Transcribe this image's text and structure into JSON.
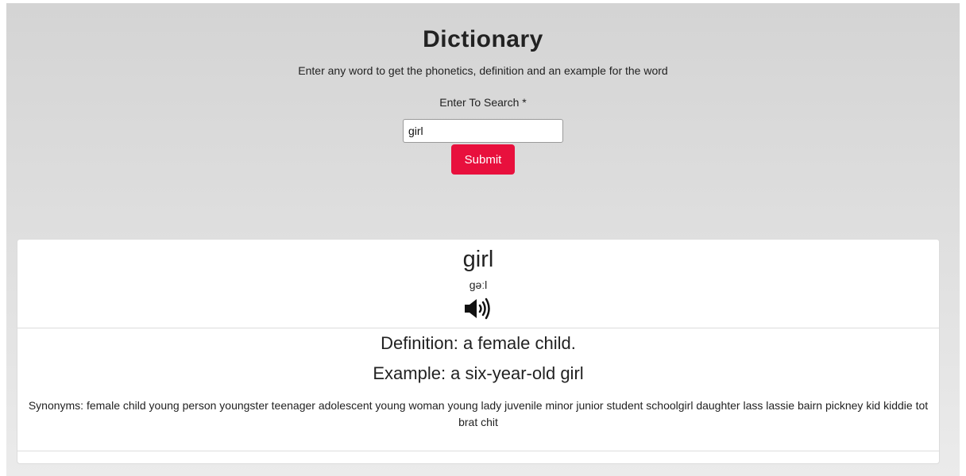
{
  "header": {
    "title": "Dictionary",
    "subtitle": "Enter any word to get the phonetics, definition and an example for the word"
  },
  "search": {
    "label": "Enter To Search *",
    "value": "girl",
    "submit_label": "Submit"
  },
  "result": {
    "word": "girl",
    "phonetic": "ɡəːl",
    "audio_icon": "speaker-volume-icon",
    "definition": "Definition: a female child.",
    "example": "Example: a six-year-old girl",
    "synonyms": "Synonyms: female child young person youngster teenager adolescent young woman young lady juvenile minor junior student schoolgirl daughter lass lassie bairn pickney kid kiddie tot brat chit"
  },
  "colors": {
    "accent": "#e8103d"
  }
}
